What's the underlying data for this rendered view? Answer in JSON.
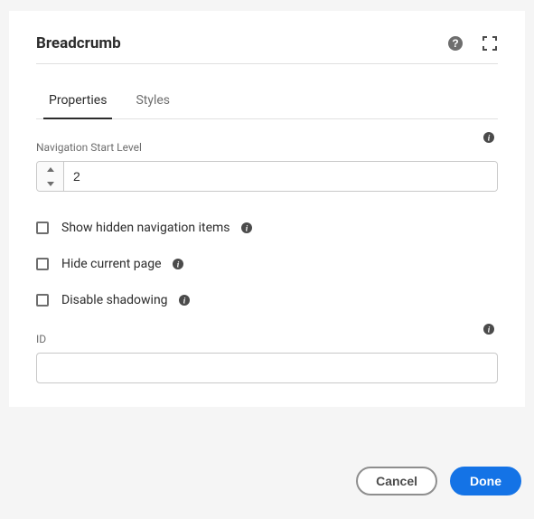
{
  "header": {
    "title": "Breadcrumb"
  },
  "tabs": {
    "properties": "Properties",
    "styles": "Styles"
  },
  "fields": {
    "navStartLabel": "Navigation Start Level",
    "navStartValue": "2",
    "showHiddenLabel": "Show hidden navigation items",
    "hideCurrentLabel": "Hide current page",
    "disableShadowLabel": "Disable shadowing",
    "idLabel": "ID",
    "idValue": ""
  },
  "buttons": {
    "cancel": "Cancel",
    "done": "Done"
  }
}
